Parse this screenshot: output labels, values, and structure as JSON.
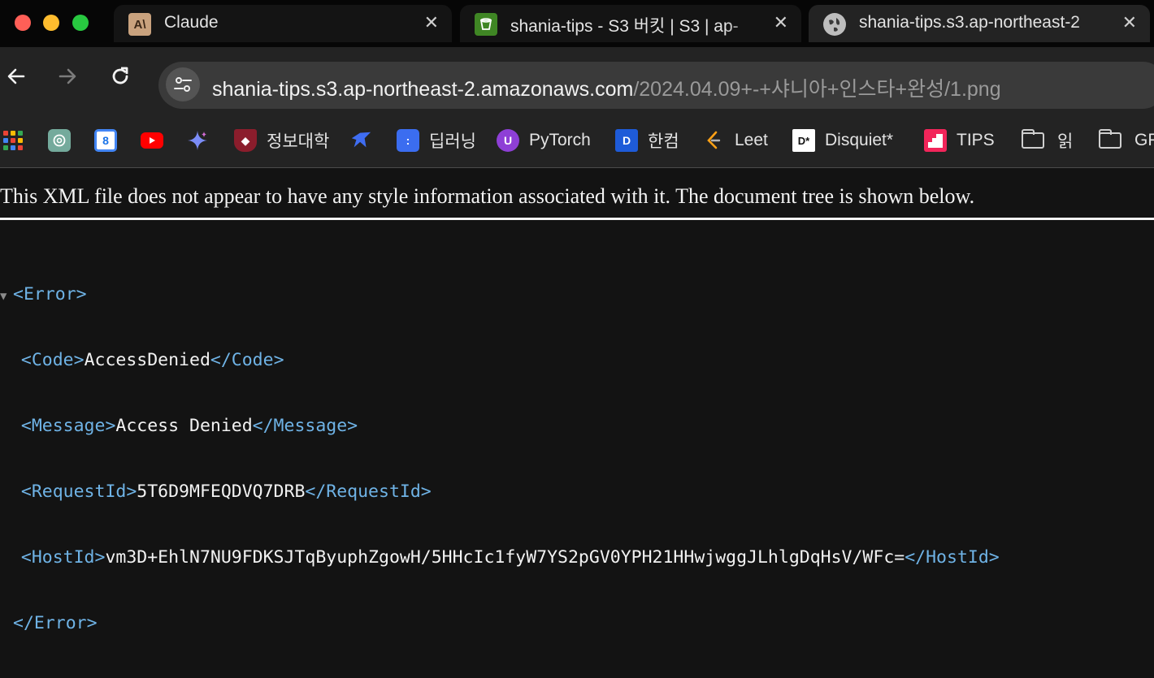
{
  "window": {
    "tabs": [
      {
        "title": "Claude",
        "favicon": "claude-logo-icon",
        "active": false
      },
      {
        "title": "shania-tips - S3 버킷 | S3 | ap-",
        "favicon": "aws-s3-icon",
        "active": false
      },
      {
        "title": "shania-tips.s3.ap-northeast-2",
        "favicon": "globe-icon",
        "active": true
      }
    ],
    "close_glyph": "✕"
  },
  "toolbar": {
    "url_host": "shania-tips.s3.ap-northeast-2.amazonaws.com",
    "url_path": "/2024.04.09+-+샤니아+인스타+완성/1.png"
  },
  "bookmarks": [
    {
      "label": "",
      "icon": "apps-grid-icon"
    },
    {
      "label": "",
      "icon": "chatgpt-icon"
    },
    {
      "label": "",
      "icon": "google-calendar-icon"
    },
    {
      "label": "",
      "icon": "youtube-icon"
    },
    {
      "label": "",
      "icon": "gemini-icon"
    },
    {
      "label": "정보대학",
      "icon": "university-crest-icon"
    },
    {
      "label": "",
      "icon": "bird-icon"
    },
    {
      "label": "딥러닝",
      "icon": "dl-icon"
    },
    {
      "label": "PyTorch",
      "icon": "pytorch-icon"
    },
    {
      "label": "한컴",
      "icon": "hancom-icon"
    },
    {
      "label": "Leet",
      "icon": "leetcode-icon"
    },
    {
      "label": "Disquiet*",
      "icon": "disquiet-icon"
    },
    {
      "label": "TIPS",
      "icon": "tips-icon"
    },
    {
      "label": "읽",
      "icon": "folder-icon"
    },
    {
      "label": "GP",
      "icon": "folder-icon"
    }
  ],
  "content": {
    "notice": "This XML file does not appear to have any style information associated with it. The document tree is shown below.",
    "xml": {
      "root_open": "<Error>",
      "root_close": "</Error>",
      "code": {
        "open": "<Code>",
        "value": "AccessDenied",
        "close": "</Code>"
      },
      "message": {
        "open": "<Message>",
        "value": "Access Denied",
        "close": "</Message>"
      },
      "request_id": {
        "open": "<RequestId>",
        "value": "5T6D9MFEQDVQ7DRB",
        "close": "</RequestId>"
      },
      "host_id": {
        "open": "<HostId>",
        "value": "vm3D+EhlN7NU9FDKSJTqByuphZgowH/5HHcIc1fyW7YS2pGV0YPH21HHwjwggJLhlgDqHsV/WFc=",
        "close": "</HostId>"
      }
    }
  },
  "colors": {
    "tag": "#6fb3e6",
    "text": "#f2f2f2",
    "background": "#131313"
  }
}
